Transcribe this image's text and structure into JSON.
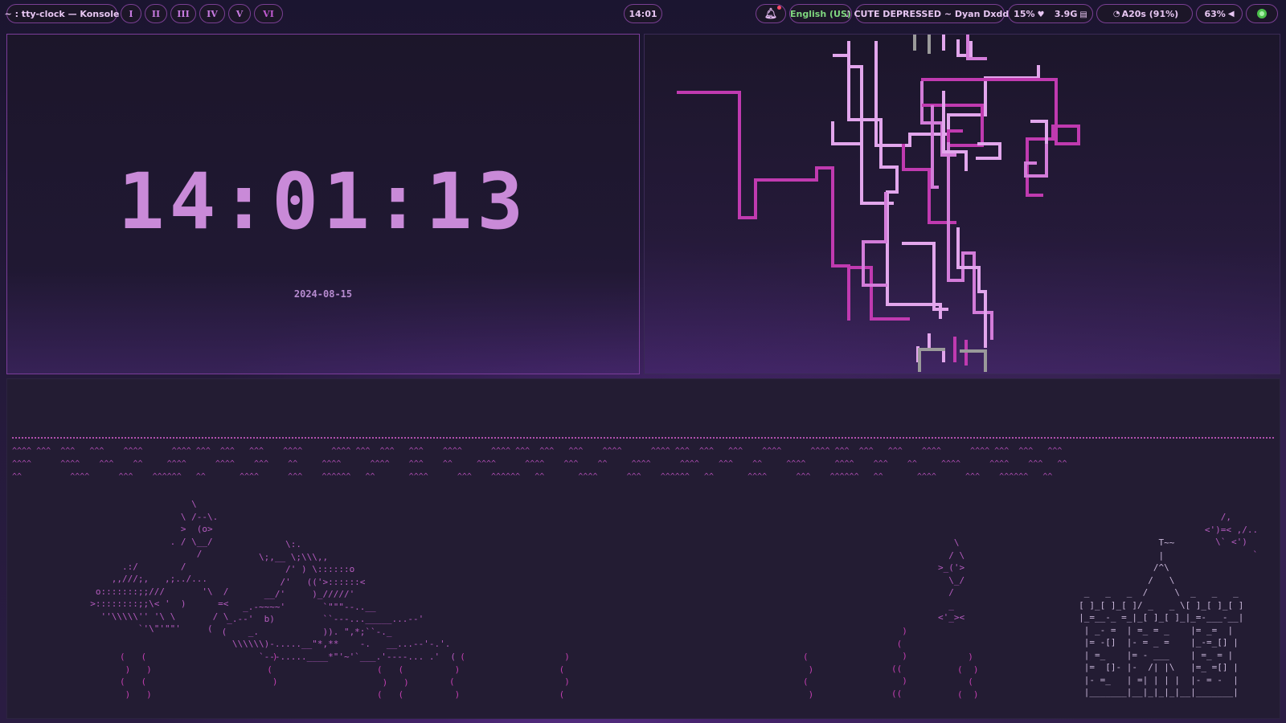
{
  "topbar": {
    "window_title": "~ : tty-clock — Konsole",
    "workspaces": [
      "I",
      "II",
      "III",
      "IV",
      "V",
      "VI"
    ],
    "active_workspace": "VI",
    "clock": "14:01",
    "notification_icon": "bell-icon",
    "keyboard_layout": "English (US)",
    "media": "♪ CUTE DEPRESSED ~ Dyan Dxddy",
    "cpu": "15%",
    "cpu_icon": "heart-icon",
    "memory": "3.9G",
    "memory_icon": "memory-icon",
    "network": "A20s (91%)",
    "network_icon": "wifi-icon",
    "volume": "63%",
    "volume_icon": "speaker-icon",
    "status_icon": "green-circle-icon",
    "colors": {
      "accent": "#7a3f93",
      "text": "#e7c6f2",
      "green": "#7fd67f"
    }
  },
  "clock_window": {
    "time": "14:01:13",
    "date": "2024-08-15"
  },
  "pipes_window": {
    "app": "pipes",
    "colors": [
      "#c03ab0",
      "#d37cd9",
      "#e2a6ec",
      "#9a9a9a"
    ]
  },
  "aquarium_window": {
    "waves": [
      "^^^^ ^^^  ^^^   ^^^    ^^^^      ^^^^ ^^^  ^^^   ^^^    ^^^^      ^^^^ ^^^  ^^^   ^^^    ^^^^      ^^^^ ^^^  ^^^   ^^^    ^^^^      ^^^^ ^^^  ^^^   ^^^    ^^^^      ^^^^ ^^^  ^^^   ^^^    ^^^^      ^^^^ ^^^  ^^^   ^^^",
      "^^^^      ^^^^    ^^^    ^^     ^^^^      ^^^^    ^^^    ^^     ^^^^      ^^^^    ^^^    ^^     ^^^^      ^^^^    ^^^    ^^     ^^^^      ^^^^    ^^^    ^^     ^^^^      ^^^^    ^^^    ^^     ^^^^      ^^^^    ^^^   ^^",
      "^^          ^^^^      ^^^    ^^^^^^   ^^       ^^^^      ^^^    ^^^^^^   ^^       ^^^^      ^^^    ^^^^^^   ^^       ^^^^      ^^^    ^^^^^^   ^^       ^^^^      ^^^    ^^^^^^   ^^       ^^^^      ^^^    ^^^^^^   ^^"
    ],
    "art_left": "                     \\\n                   \\ /--\\.\n                   >  (o>\n                 . / \\__/\n                      /\n        .:/        /\n      ,,///;,   ,;../...\n   o:::::::;;///       '\\  /\n  >::::::::;;\\< '  )      =<\n    ''\\\\\\\\\\'' '\\ \\       / \\\n           `'\\\"'\"\"'     (\n",
    "art_mid": "             \\:.\n        \\;,__ \\;\\\\\\,,\n             /' ) \\::::::o\n            /'   (('>::::::<\n         __/'     )_/////'\n     _.-~~~~'       `\"\"\"--..__\n  _.--'  b)         ``---..._____...--'\n (    _.            )). \",*;``-._\n   \\\\\\\\\\\\)-.....__\"*,**    -.   __...--'-.'.\n        `---.....____*\"'~'`___.'----... .'  (\n",
    "art_castle": "                    T~~\n                    |\n                   /^\\\n                  /   \\\n      _   _   _  /     \\  _   _   _\n     [ ]_[ ]_[ ]/ _   _ \\[ ]_[ ]_[ ]\n     |_=__-_ =_|_[ ]_[ ]_|_=-___-__|\n      | _- =  | =_ = _    |= _=  |\n      |= -[]  |- = _ =    |_-=_[] |\n      | =_    |= - ___    | =_ = |\n      |=  []- |-  /| |\\   |=_ =[] |\n      |- =_   | =| | | |  |- = -  |\n      |_______|__|_|_|_|__|_______|",
    "art_right_fish": "      /,\n   <')=< ,/..\n     \\` <')\n            `\n",
    "art_small_fish": "   \\\n  / \\\n>_('>\n  \\_/\n  /\n  _\n<'_><"
  }
}
